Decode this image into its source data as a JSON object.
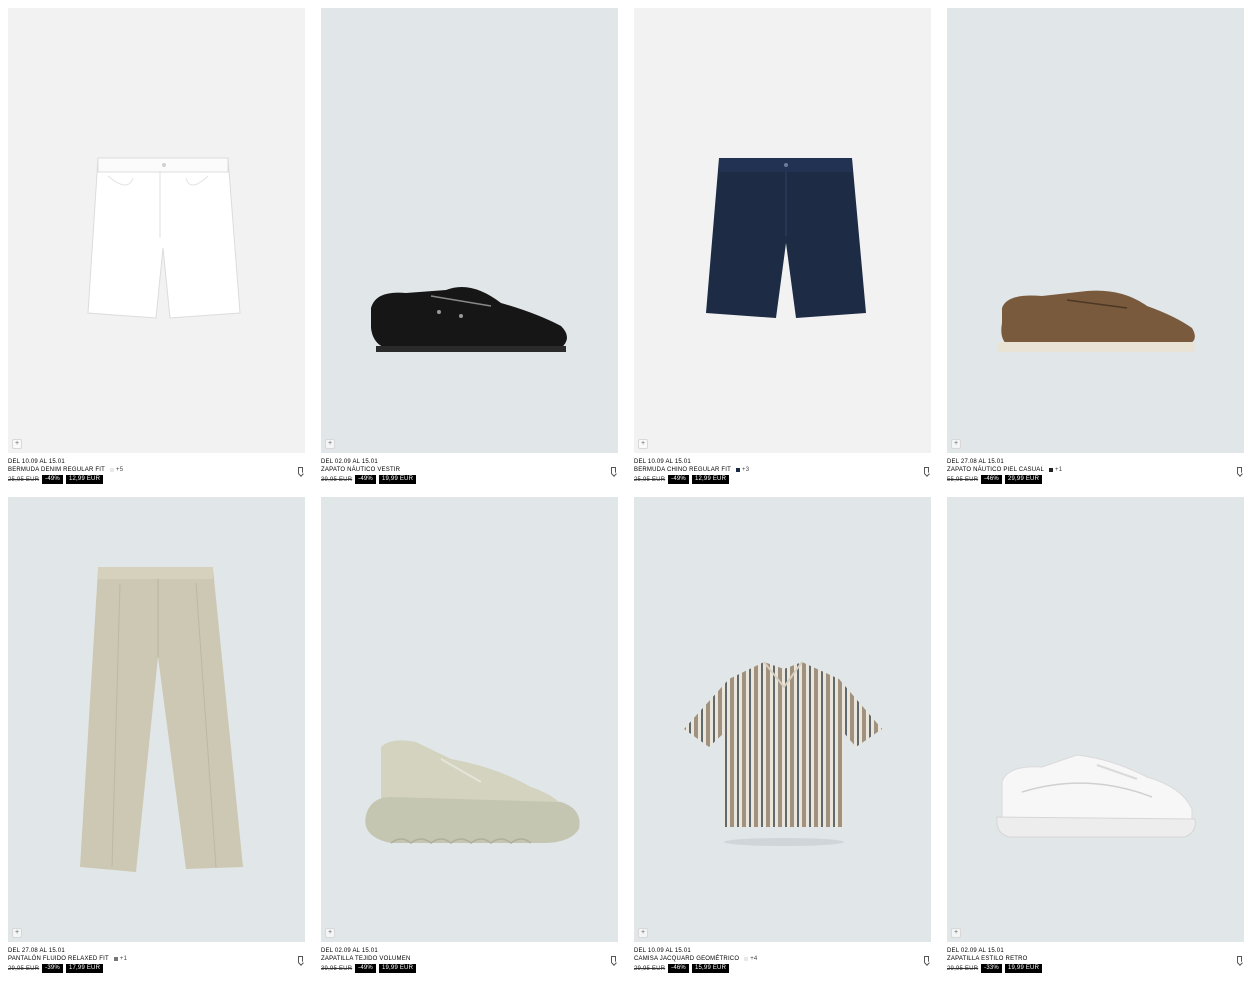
{
  "products": [
    {
      "dates": "DEL 10.09 AL 15.01",
      "name": "BERMUDA DENIM REGULAR FIT",
      "colors_count": "+5",
      "swatch_color": "#e9e9e9",
      "old_price": "25,95 EUR",
      "discount": "-49%",
      "price": "12,99 EUR",
      "bg": "#f2f2f2",
      "icon": "white-denim-shorts"
    },
    {
      "dates": "DEL 02.09 AL 15.01",
      "name": "ZAPATO NÁUTICO VESTIR",
      "colors_count": "",
      "swatch_color": "",
      "old_price": "39,95 EUR",
      "discount": "-49%",
      "price": "19,99 EUR",
      "bg": "#e1e6e9",
      "icon": "black-boat-shoe"
    },
    {
      "dates": "DEL 10.09 AL 15.01",
      "name": "BERMUDA CHINO REGULAR FIT",
      "colors_count": "+3",
      "swatch_color": "#1a2a44",
      "old_price": "25,95 EUR",
      "discount": "-49%",
      "price": "12,99 EUR",
      "bg": "#f2f2f2",
      "icon": "navy-chino-shorts"
    },
    {
      "dates": "DEL 27.08 AL 15.01",
      "name": "ZAPATO NÁUTICO PIEL CASUAL",
      "colors_count": "+1",
      "swatch_color": "#222222",
      "old_price": "55,95 EUR",
      "discount": "-46%",
      "price": "29,99 EUR",
      "bg": "#e1e6e9",
      "icon": "brown-suede-boat-shoe"
    },
    {
      "dates": "DEL 27.08 AL 15.01",
      "name": "PANTALÓN FLUIDO RELAXED FIT",
      "colors_count": "+1",
      "swatch_color": "#777777",
      "old_price": "29,95 EUR",
      "discount": "-39%",
      "price": "17,99 EUR",
      "bg": "#e1e6e9",
      "icon": "beige-trousers"
    },
    {
      "dates": "DEL 02.09 AL 15.01",
      "name": "ZAPATILLA TEJIDO VOLUMEN",
      "colors_count": "",
      "swatch_color": "",
      "old_price": "39,95 EUR",
      "discount": "-49%",
      "price": "19,99 EUR",
      "bg": "#e1e6e9",
      "icon": "chunky-knit-sneaker"
    },
    {
      "dates": "DEL 10.09 AL 15.01",
      "name": "CAMISA JACQUARD GEOMÉTRICO",
      "colors_count": "+4",
      "swatch_color": "#e9e9e9",
      "old_price": "29,95 EUR",
      "discount": "-46%",
      "price": "15,99 EUR",
      "bg": "#e1e6e9",
      "icon": "striped-shirt"
    },
    {
      "dates": "DEL 02.09 AL 15.01",
      "name": "ZAPATILLA ESTILO RETRO",
      "colors_count": "",
      "swatch_color": "",
      "old_price": "29,95 EUR",
      "discount": "-33%",
      "price": "19,99 EUR",
      "bg": "#e1e6e9",
      "icon": "white-retro-sneaker"
    }
  ]
}
